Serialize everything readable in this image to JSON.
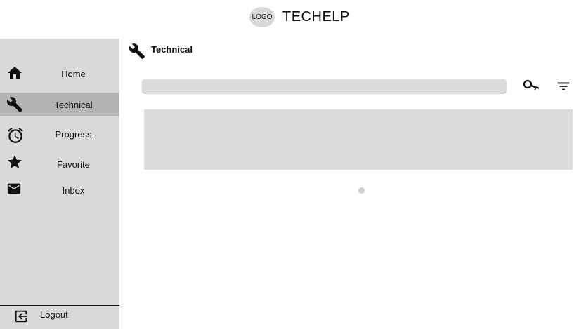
{
  "header": {
    "logo_text": "LOGO",
    "app_title": "TECHELP"
  },
  "sidebar": {
    "items": [
      {
        "label": "Home",
        "icon": "home-icon",
        "active": false
      },
      {
        "label": "Technical",
        "icon": "wrench-icon",
        "active": true
      },
      {
        "label": "Progress",
        "icon": "alarm-clock-icon",
        "active": false
      },
      {
        "label": "Favorite",
        "icon": "star-icon",
        "active": false
      },
      {
        "label": "Inbox",
        "icon": "mail-icon",
        "active": false
      }
    ],
    "logout": {
      "label": "Logout",
      "icon": "logout-icon"
    }
  },
  "main": {
    "title": "Technical",
    "title_icon": "wrench-icon",
    "search": {
      "value": "",
      "placeholder": ""
    },
    "actions": {
      "search_icon": "key-search-icon",
      "filter_icon": "filter-icon"
    },
    "pagination": {
      "pages": 1,
      "current": 1
    }
  },
  "colors": {
    "sidebar_bg": "#d9d9d9",
    "active_item_bg": "#b3b3b3",
    "content_placeholder": "#dcdcdc"
  }
}
